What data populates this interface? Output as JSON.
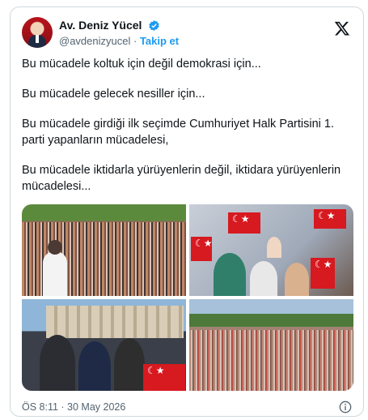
{
  "header": {
    "display_name": "Av. Deniz Yücel",
    "handle": "@avdenizyucel",
    "separator": "·",
    "follow_label": "Takip et"
  },
  "body": {
    "paragraphs": [
      "Bu mücadele koltuk için değil demokrasi için...",
      "Bu mücadele gelecek nesiller için...",
      "Bu mücadele girdiği ilk seçimde Cumhuriyet Halk Partisini 1. parti yapanların mücadelesi,",
      "Bu mücadele iktidarla yürüyenlerin değil, iktidara yürüyenlerin mücadelesi..."
    ]
  },
  "footer": {
    "timestamp": "ÖS 8:11 · 30 May 2026"
  },
  "icons": {
    "verified": "verified-badge-icon",
    "x_logo": "x-logo-icon",
    "info": "info-icon"
  },
  "colors": {
    "accent": "#1d9bf0",
    "muted_text": "#536471",
    "border": "#cfd9de",
    "flag_red": "#d71920"
  }
}
